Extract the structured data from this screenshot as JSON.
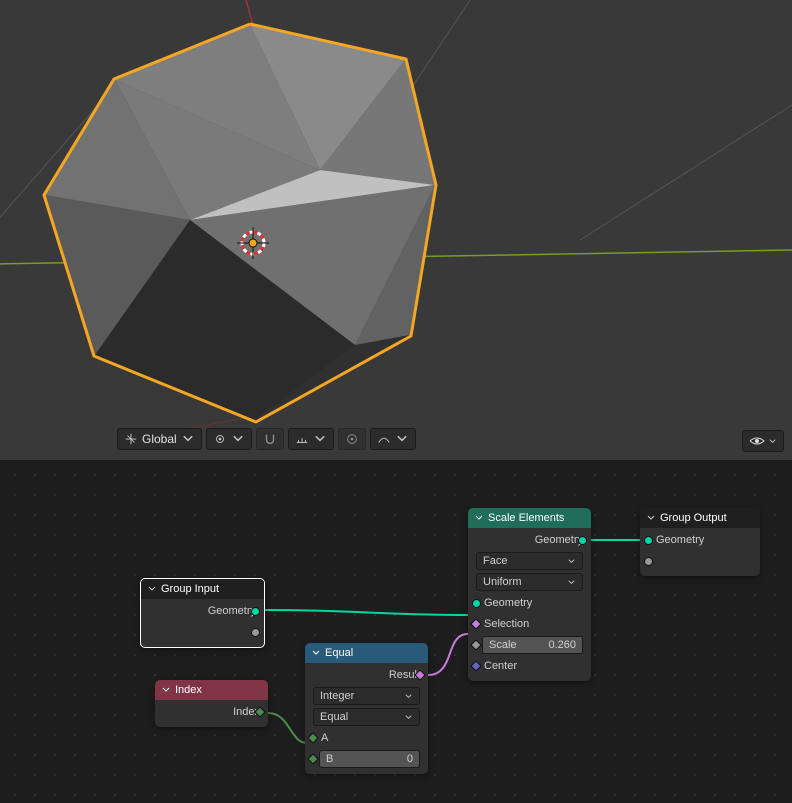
{
  "toolbar": {
    "global": "Global"
  },
  "nodes": {
    "group_input": {
      "title": "Group Input",
      "geometry": "Geometry"
    },
    "index": {
      "title": "Index",
      "out": "Index"
    },
    "equal": {
      "title": "Equal",
      "result": "Result",
      "mode": "Integer",
      "op": "Equal",
      "a": "A",
      "b": "B",
      "bval": "0"
    },
    "scale": {
      "title": "Scale Elements",
      "geo_out": "Geometry",
      "domain": "Face",
      "mode": "Uniform",
      "geo_in": "Geometry",
      "selection": "Selection",
      "scale_label": "Scale",
      "scale_val": "0.260",
      "center": "Center"
    },
    "output": {
      "title": "Group Output",
      "geo": "Geometry"
    }
  }
}
